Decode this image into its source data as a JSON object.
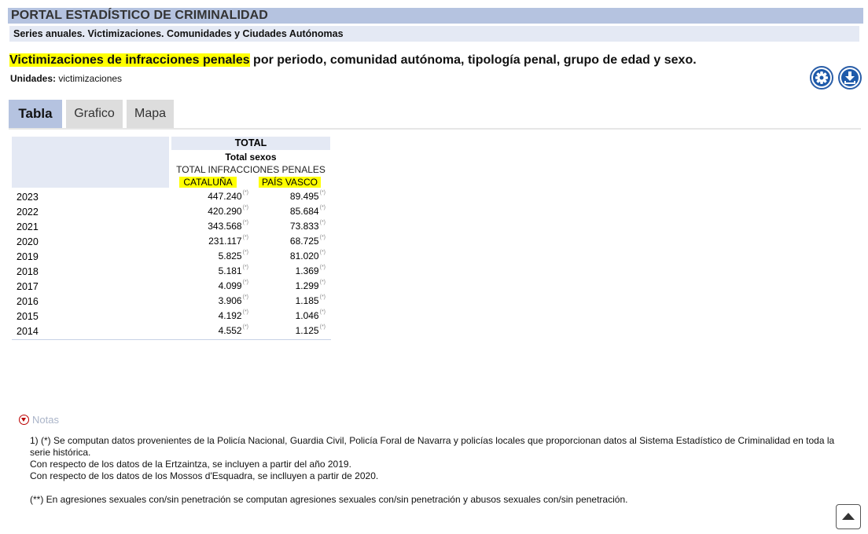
{
  "portal_title": "PORTAL ESTADÍSTICO DE CRIMINALIDAD",
  "series_title": "Series anuales. Victimizaciones. Comunidades y Ciudades Autónomas",
  "main_title": {
    "highlight": "Victimizaciones de infracciones penales",
    "rest": " por periodo, comunidad autónoma, tipología penal, grupo de edad y sexo."
  },
  "units": {
    "label": "Unidades:",
    "value": " victimizaciones"
  },
  "toolbar": {
    "settings_icon": "gear-icon",
    "download_icon": "download-icon",
    "accent": "#1e5aaa"
  },
  "tabs": [
    {
      "label": "Tabla",
      "active": true
    },
    {
      "label": "Grafico",
      "active": false
    },
    {
      "label": "Mapa",
      "active": false
    }
  ],
  "table": {
    "header_total": "TOTAL",
    "header_sexos": "Total sexos",
    "header_infracciones": "TOTAL INFRACCIONES PENALES",
    "columns": [
      "CATALUÑA",
      "PAÍS VASCO"
    ],
    "flag": "(*)",
    "rows": [
      {
        "year": "2023",
        "values": [
          "447.240",
          "89.495"
        ]
      },
      {
        "year": "2022",
        "values": [
          "420.290",
          "85.684"
        ]
      },
      {
        "year": "2021",
        "values": [
          "343.568",
          "73.833"
        ]
      },
      {
        "year": "2020",
        "values": [
          "231.117",
          "68.725"
        ]
      },
      {
        "year": "2019",
        "values": [
          "5.825",
          "81.020"
        ]
      },
      {
        "year": "2018",
        "values": [
          "5.181",
          "1.369"
        ]
      },
      {
        "year": "2017",
        "values": [
          "4.099",
          "1.299"
        ]
      },
      {
        "year": "2016",
        "values": [
          "3.906",
          "1.185"
        ]
      },
      {
        "year": "2015",
        "values": [
          "4.192",
          "1.046"
        ]
      },
      {
        "year": "2014",
        "values": [
          "4.552",
          "1.125"
        ]
      }
    ]
  },
  "notes": {
    "heading": "Notas",
    "line1": "1) (*) Se computan datos provenientes de la Policía Nacional, Guardia Civil, Policía Foral de Navarra y policías locales que proporcionan datos al Sistema Estadístico de Criminalidad en toda la serie histórica.",
    "line2": "Con respecto de los datos de la Ertzaintza, se incluyen a partir del año 2019.",
    "line3": "Con respecto de los datos de los Mossos d'Esquadra, se inclluyen a partir de 2020.",
    "line4": "(**) En agresiones sexuales con/sin penetración se computan agresiones sexuales con/sin penetración y abusos sexuales con/sin penetración."
  },
  "scroll_top_icon": "arrow-up-icon"
}
